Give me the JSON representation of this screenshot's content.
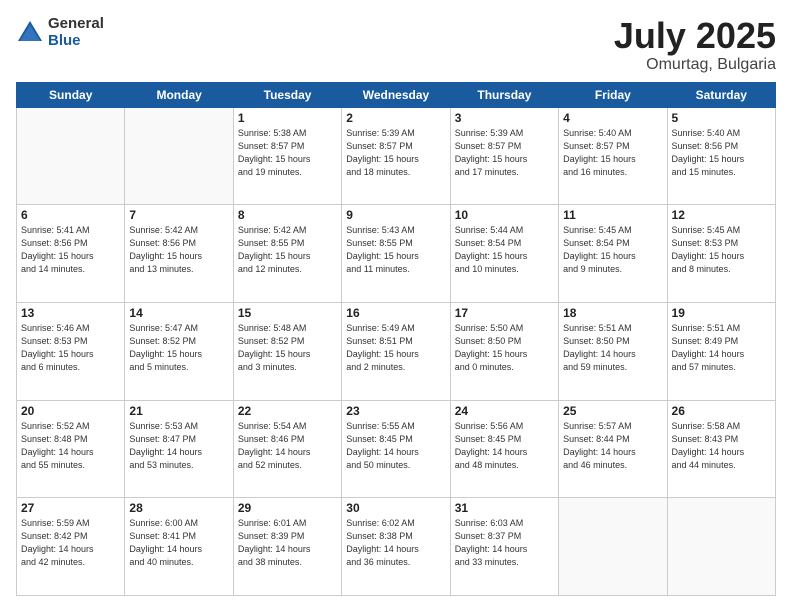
{
  "logo": {
    "general": "General",
    "blue": "Blue"
  },
  "title": "July 2025",
  "subtitle": "Omurtag, Bulgaria",
  "days_header": [
    "Sunday",
    "Monday",
    "Tuesday",
    "Wednesday",
    "Thursday",
    "Friday",
    "Saturday"
  ],
  "weeks": [
    [
      {
        "day": "",
        "info": ""
      },
      {
        "day": "",
        "info": ""
      },
      {
        "day": "1",
        "info": "Sunrise: 5:38 AM\nSunset: 8:57 PM\nDaylight: 15 hours\nand 19 minutes."
      },
      {
        "day": "2",
        "info": "Sunrise: 5:39 AM\nSunset: 8:57 PM\nDaylight: 15 hours\nand 18 minutes."
      },
      {
        "day": "3",
        "info": "Sunrise: 5:39 AM\nSunset: 8:57 PM\nDaylight: 15 hours\nand 17 minutes."
      },
      {
        "day": "4",
        "info": "Sunrise: 5:40 AM\nSunset: 8:57 PM\nDaylight: 15 hours\nand 16 minutes."
      },
      {
        "day": "5",
        "info": "Sunrise: 5:40 AM\nSunset: 8:56 PM\nDaylight: 15 hours\nand 15 minutes."
      }
    ],
    [
      {
        "day": "6",
        "info": "Sunrise: 5:41 AM\nSunset: 8:56 PM\nDaylight: 15 hours\nand 14 minutes."
      },
      {
        "day": "7",
        "info": "Sunrise: 5:42 AM\nSunset: 8:56 PM\nDaylight: 15 hours\nand 13 minutes."
      },
      {
        "day": "8",
        "info": "Sunrise: 5:42 AM\nSunset: 8:55 PM\nDaylight: 15 hours\nand 12 minutes."
      },
      {
        "day": "9",
        "info": "Sunrise: 5:43 AM\nSunset: 8:55 PM\nDaylight: 15 hours\nand 11 minutes."
      },
      {
        "day": "10",
        "info": "Sunrise: 5:44 AM\nSunset: 8:54 PM\nDaylight: 15 hours\nand 10 minutes."
      },
      {
        "day": "11",
        "info": "Sunrise: 5:45 AM\nSunset: 8:54 PM\nDaylight: 15 hours\nand 9 minutes."
      },
      {
        "day": "12",
        "info": "Sunrise: 5:45 AM\nSunset: 8:53 PM\nDaylight: 15 hours\nand 8 minutes."
      }
    ],
    [
      {
        "day": "13",
        "info": "Sunrise: 5:46 AM\nSunset: 8:53 PM\nDaylight: 15 hours\nand 6 minutes."
      },
      {
        "day": "14",
        "info": "Sunrise: 5:47 AM\nSunset: 8:52 PM\nDaylight: 15 hours\nand 5 minutes."
      },
      {
        "day": "15",
        "info": "Sunrise: 5:48 AM\nSunset: 8:52 PM\nDaylight: 15 hours\nand 3 minutes."
      },
      {
        "day": "16",
        "info": "Sunrise: 5:49 AM\nSunset: 8:51 PM\nDaylight: 15 hours\nand 2 minutes."
      },
      {
        "day": "17",
        "info": "Sunrise: 5:50 AM\nSunset: 8:50 PM\nDaylight: 15 hours\nand 0 minutes."
      },
      {
        "day": "18",
        "info": "Sunrise: 5:51 AM\nSunset: 8:50 PM\nDaylight: 14 hours\nand 59 minutes."
      },
      {
        "day": "19",
        "info": "Sunrise: 5:51 AM\nSunset: 8:49 PM\nDaylight: 14 hours\nand 57 minutes."
      }
    ],
    [
      {
        "day": "20",
        "info": "Sunrise: 5:52 AM\nSunset: 8:48 PM\nDaylight: 14 hours\nand 55 minutes."
      },
      {
        "day": "21",
        "info": "Sunrise: 5:53 AM\nSunset: 8:47 PM\nDaylight: 14 hours\nand 53 minutes."
      },
      {
        "day": "22",
        "info": "Sunrise: 5:54 AM\nSunset: 8:46 PM\nDaylight: 14 hours\nand 52 minutes."
      },
      {
        "day": "23",
        "info": "Sunrise: 5:55 AM\nSunset: 8:45 PM\nDaylight: 14 hours\nand 50 minutes."
      },
      {
        "day": "24",
        "info": "Sunrise: 5:56 AM\nSunset: 8:45 PM\nDaylight: 14 hours\nand 48 minutes."
      },
      {
        "day": "25",
        "info": "Sunrise: 5:57 AM\nSunset: 8:44 PM\nDaylight: 14 hours\nand 46 minutes."
      },
      {
        "day": "26",
        "info": "Sunrise: 5:58 AM\nSunset: 8:43 PM\nDaylight: 14 hours\nand 44 minutes."
      }
    ],
    [
      {
        "day": "27",
        "info": "Sunrise: 5:59 AM\nSunset: 8:42 PM\nDaylight: 14 hours\nand 42 minutes."
      },
      {
        "day": "28",
        "info": "Sunrise: 6:00 AM\nSunset: 8:41 PM\nDaylight: 14 hours\nand 40 minutes."
      },
      {
        "day": "29",
        "info": "Sunrise: 6:01 AM\nSunset: 8:39 PM\nDaylight: 14 hours\nand 38 minutes."
      },
      {
        "day": "30",
        "info": "Sunrise: 6:02 AM\nSunset: 8:38 PM\nDaylight: 14 hours\nand 36 minutes."
      },
      {
        "day": "31",
        "info": "Sunrise: 6:03 AM\nSunset: 8:37 PM\nDaylight: 14 hours\nand 33 minutes."
      },
      {
        "day": "",
        "info": ""
      },
      {
        "day": "",
        "info": ""
      }
    ]
  ]
}
